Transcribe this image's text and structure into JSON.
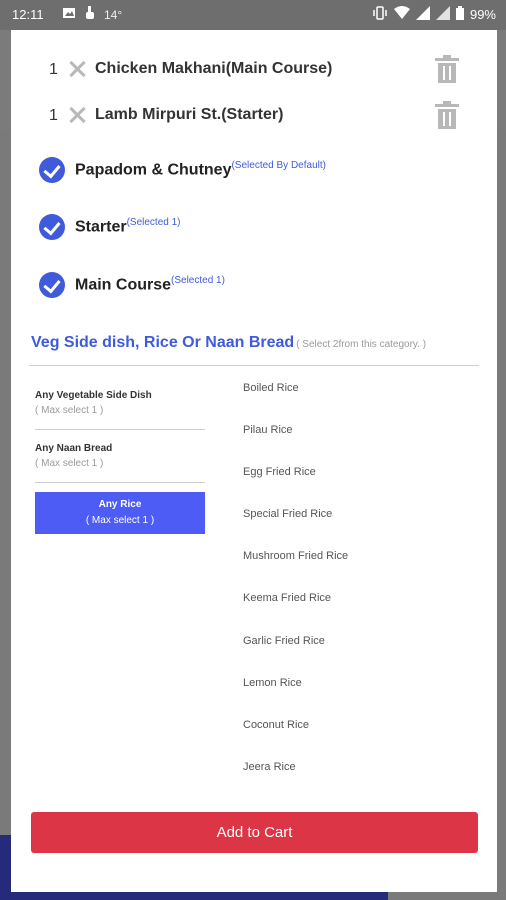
{
  "status_bar": {
    "time": "12:11",
    "temperature": "14°",
    "battery": "99%"
  },
  "cart_items": [
    {
      "qty": "1",
      "name": "Chicken Makhani(Main Course)"
    },
    {
      "qty": "1",
      "name": "Lamb Mirpuri St.(Starter)"
    }
  ],
  "selections": [
    {
      "label": "Papadom & Chutney",
      "note": "(Selected By Default)"
    },
    {
      "label": "Starter",
      "note": "(Selected 1)"
    },
    {
      "label": "Main Course",
      "note": "(Selected 1)"
    }
  ],
  "category": {
    "title": "Veg Side dish, Rice Or Naan Bread",
    "note": "( Select 2from this category. )"
  },
  "subcategories": [
    {
      "title": "Any Vegetable Side Dish",
      "max": "( Max select 1 )"
    },
    {
      "title": "Any Naan Bread",
      "max": "( Max select 1 )"
    },
    {
      "title": "Any Rice",
      "max": "( Max select 1 )"
    }
  ],
  "options": [
    "Boiled Rice",
    "Pilau Rice",
    "Egg Fried Rice",
    "Special Fried Rice",
    "Mushroom Fried Rice",
    "Keema Fried Rice",
    "Garlic Fried Rice",
    "Lemon Rice",
    "Coconut Rice",
    "Jeera Rice"
  ],
  "add_to_cart_label": "Add to Cart",
  "colors": {
    "accent_blue": "#3f5bdc",
    "active_tab": "#4d5cf4",
    "add_button": "#dc3545"
  }
}
